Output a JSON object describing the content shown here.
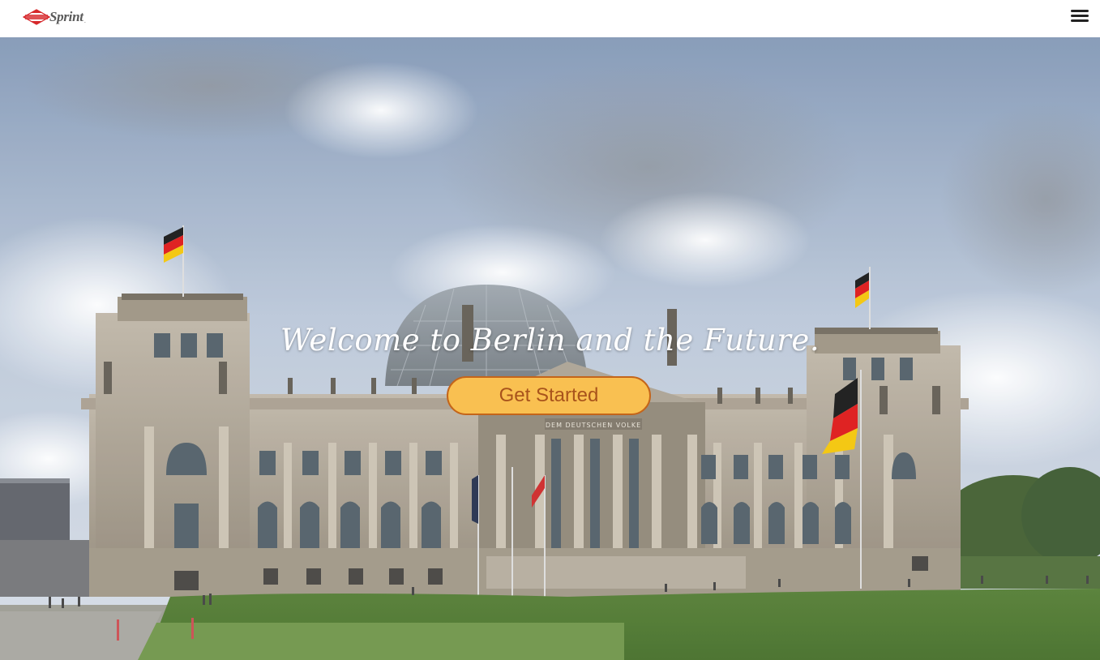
{
  "header": {
    "logo_text": "Sprint",
    "logo_trademark": ".",
    "menu_icon": "hamburger-menu-icon"
  },
  "hero": {
    "headline": "Welcome to Berlin and the Future.",
    "cta_label": "Get Started",
    "inscription": "DEM DEUTSCHEN VOLKE",
    "background": "photo of the Reichstag building in Berlin with German flags under a cloudy sky"
  },
  "colors": {
    "cta_fill": "#f9c051",
    "cta_border": "#c4651a",
    "cta_text": "#a8531c",
    "logo_red": "#d6282b"
  }
}
